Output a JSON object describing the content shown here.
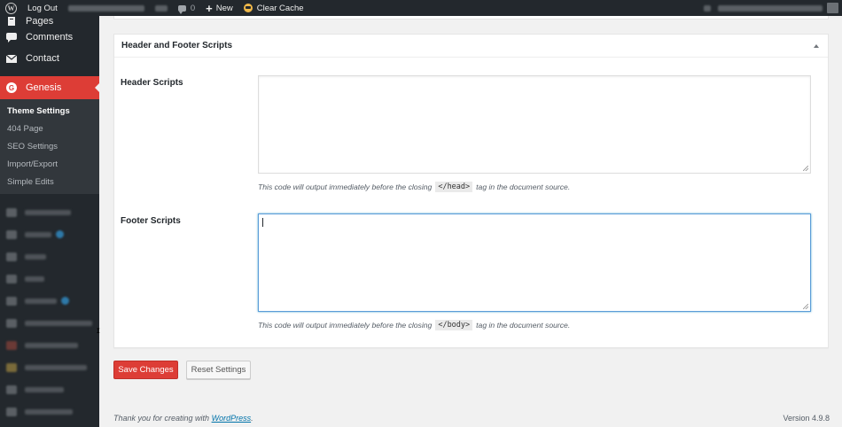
{
  "admin_bar": {
    "logout": "Log Out",
    "comments_count": "0",
    "new_label": "New",
    "clear_cache": "Clear Cache"
  },
  "sidebar": {
    "items": [
      {
        "label": "Pages",
        "icon": "pages-icon"
      },
      {
        "label": "Comments",
        "icon": "comments-icon"
      },
      {
        "label": "Contact",
        "icon": "envelope-icon"
      }
    ],
    "active": {
      "label": "Genesis",
      "icon": "genesis-icon"
    },
    "submenu": [
      "Theme Settings",
      "404 Page",
      "SEO Settings",
      "Import/Export",
      "Simple Edits"
    ]
  },
  "metabox": {
    "title": "Header and Footer Scripts",
    "header_label": "Header Scripts",
    "header_value": "",
    "header_desc_before": "This code will output immediately before the closing",
    "header_tag": "</head>",
    "header_desc_after": "tag in the document source.",
    "footer_label": "Footer Scripts",
    "footer_value": "",
    "footer_desc_before": "This code will output immediately before the closing",
    "footer_tag": "</body>",
    "footer_desc_after": "tag in the document source."
  },
  "buttons": {
    "save": "Save Changes",
    "reset": "Reset Settings"
  },
  "footer": {
    "thanks_before": "Thank you for creating with",
    "thanks_link": "WordPress",
    "thanks_after": ".",
    "version": "Version 4.9.8"
  },
  "colors": {
    "accent": "#dd3d36",
    "adminbar": "#23282d",
    "link": "#0073aa",
    "focus": "#5b9dd9"
  }
}
